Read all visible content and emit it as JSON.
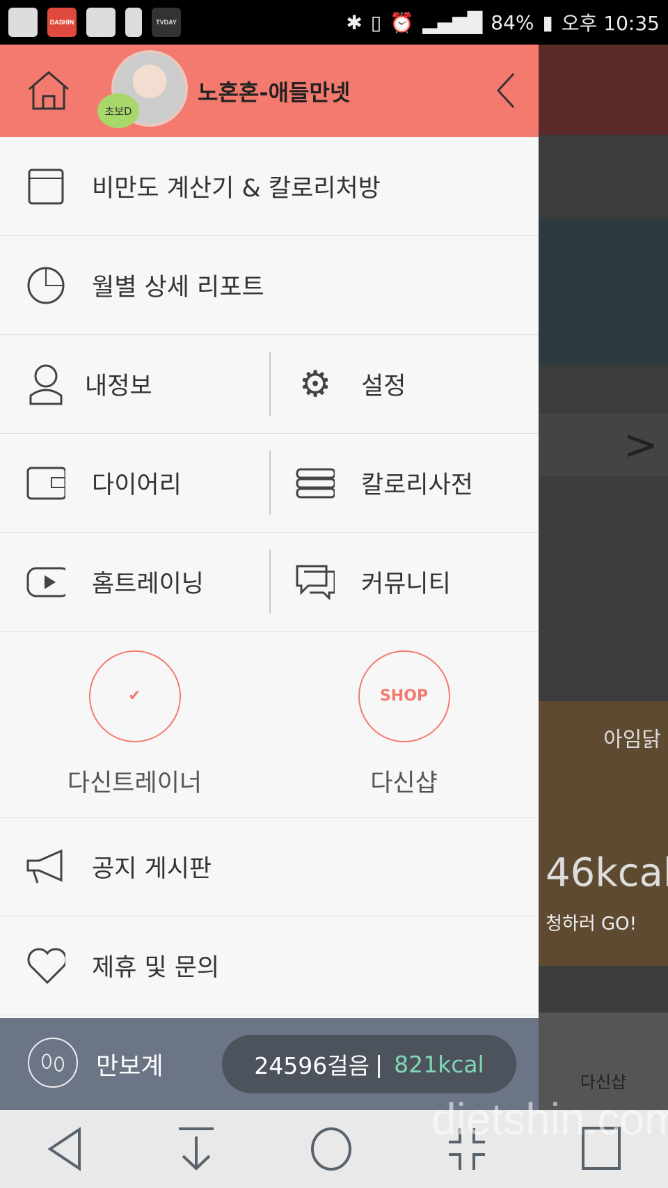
{
  "status_bar": {
    "battery": "84%",
    "time": "오후 10:35",
    "apps": [
      "U+",
      "DASHIN",
      "messenger",
      "fitness",
      "TVDAY"
    ]
  },
  "header": {
    "username": "노혼혼-애들만넷",
    "badge": "초보D"
  },
  "menu": {
    "bmi": "비만도 계산기 & 칼로리처방",
    "report": "월별 상세 리포트",
    "myinfo": "내정보",
    "settings": "설정",
    "diary": "다이어리",
    "calorie_dict": "칼로리사전",
    "home_training": "홈트레이닝",
    "community": "커뮤니티",
    "trainer": "다신트레이너",
    "shop": "다신샵",
    "shop_icon_text": "SHOP",
    "notice": "공지 게시판",
    "partnership": "제휴 및 문의"
  },
  "pedometer": {
    "label": "만보계",
    "steps": "24596걸음",
    "separator": "|",
    "kcal": "821kcal"
  },
  "background": {
    "shop_label": "다신샵",
    "ad_brand": "아임닭",
    "ad_kcal": "46kcal",
    "ad_cta": "청하러 GO!"
  },
  "watermark": "dietshin.com",
  "colors": {
    "header": "#f47a70",
    "pedometer_bg": "#6c7585",
    "kcal": "#7fd6b4"
  }
}
